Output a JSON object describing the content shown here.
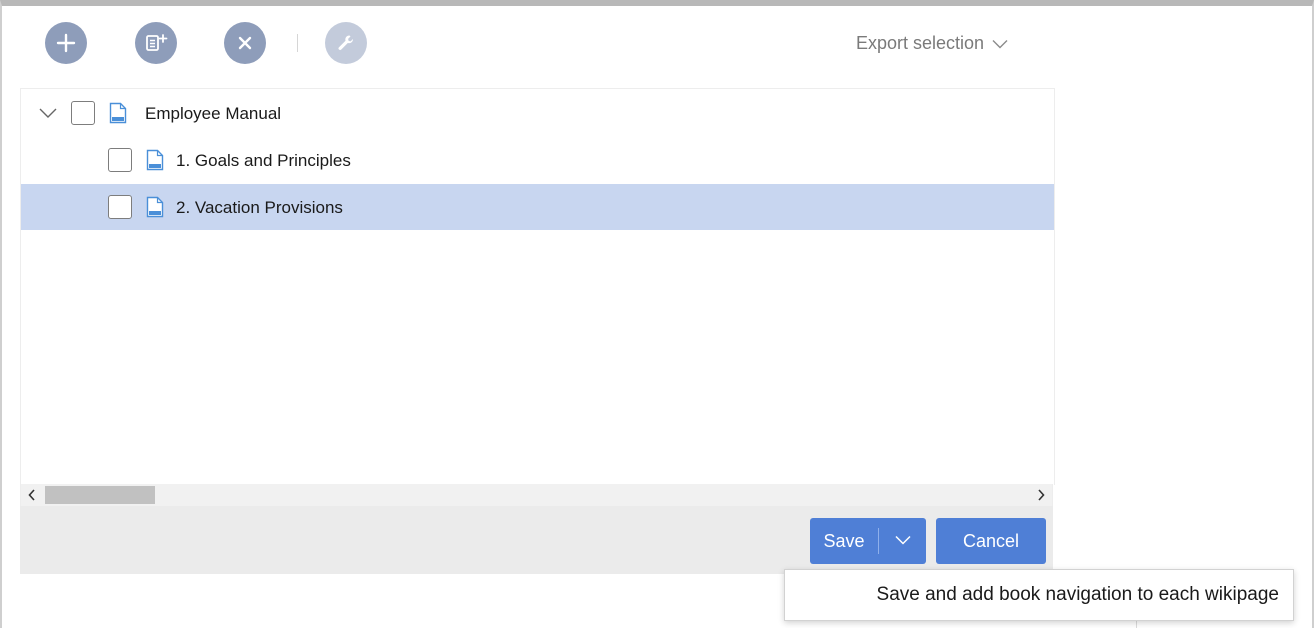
{
  "toolbar": {
    "buttons": [
      {
        "name": "add",
        "icon": "plus-icon"
      },
      {
        "name": "add-subpage",
        "icon": "page-plus-icon"
      },
      {
        "name": "remove",
        "icon": "close-icon"
      },
      {
        "name": "settings",
        "icon": "wrench-icon",
        "disabled": true
      }
    ],
    "export_label": "Export selection"
  },
  "tree": {
    "items": [
      {
        "label": "Employee Manual",
        "level": 0,
        "expanded": true,
        "selected": false,
        "checked": false
      },
      {
        "label": "1. Goals and Principles",
        "level": 1,
        "selected": false,
        "checked": false
      },
      {
        "label": "2. Vacation Provisions",
        "level": 1,
        "selected": true,
        "checked": false
      }
    ]
  },
  "footer": {
    "save_label": "Save",
    "cancel_label": "Cancel"
  },
  "menu": {
    "item_label": "Save and add book navigation to each wikipage"
  },
  "colors": {
    "accent": "#4f7fd6",
    "selected_row": "#c8d6f0",
    "toolbar_icon_bg": "#8e9dba",
    "doc_icon": "#4a8fd8"
  }
}
